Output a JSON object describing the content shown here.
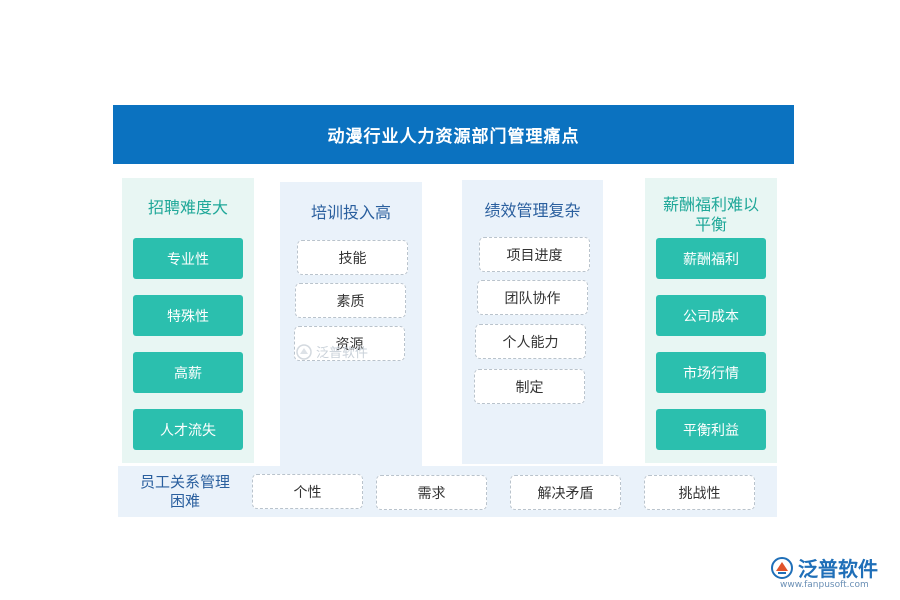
{
  "title": "动漫行业人力资源部门管理痛点",
  "columns": [
    {
      "title": "招聘难度大",
      "items": [
        "专业性",
        "特殊性",
        "高薪",
        "人才流失"
      ]
    },
    {
      "title": "培训投入高",
      "items": [
        "技能",
        "素质",
        "资源"
      ]
    },
    {
      "title": "绩效管理复杂",
      "items": [
        "项目进度",
        "团队协作",
        "个人能力",
        "制定"
      ]
    },
    {
      "title": "薪酬福利难以平衡",
      "items": [
        "薪酬福利",
        "公司成本",
        "市场行情",
        "平衡利益"
      ]
    }
  ],
  "bottom": {
    "title": "员工关系管理困难",
    "items": [
      "个性",
      "需求",
      "解决矛盾",
      "挑战性"
    ]
  },
  "watermark": {
    "text": "泛普软件"
  },
  "logo": {
    "text": "泛普软件",
    "url": "www.fanpusoft.com"
  },
  "colors": {
    "banner": "#0b72c0",
    "teal": "#2bbfae",
    "panel_teal": "#e8f6f3",
    "panel_blue": "#eaf2fa"
  }
}
